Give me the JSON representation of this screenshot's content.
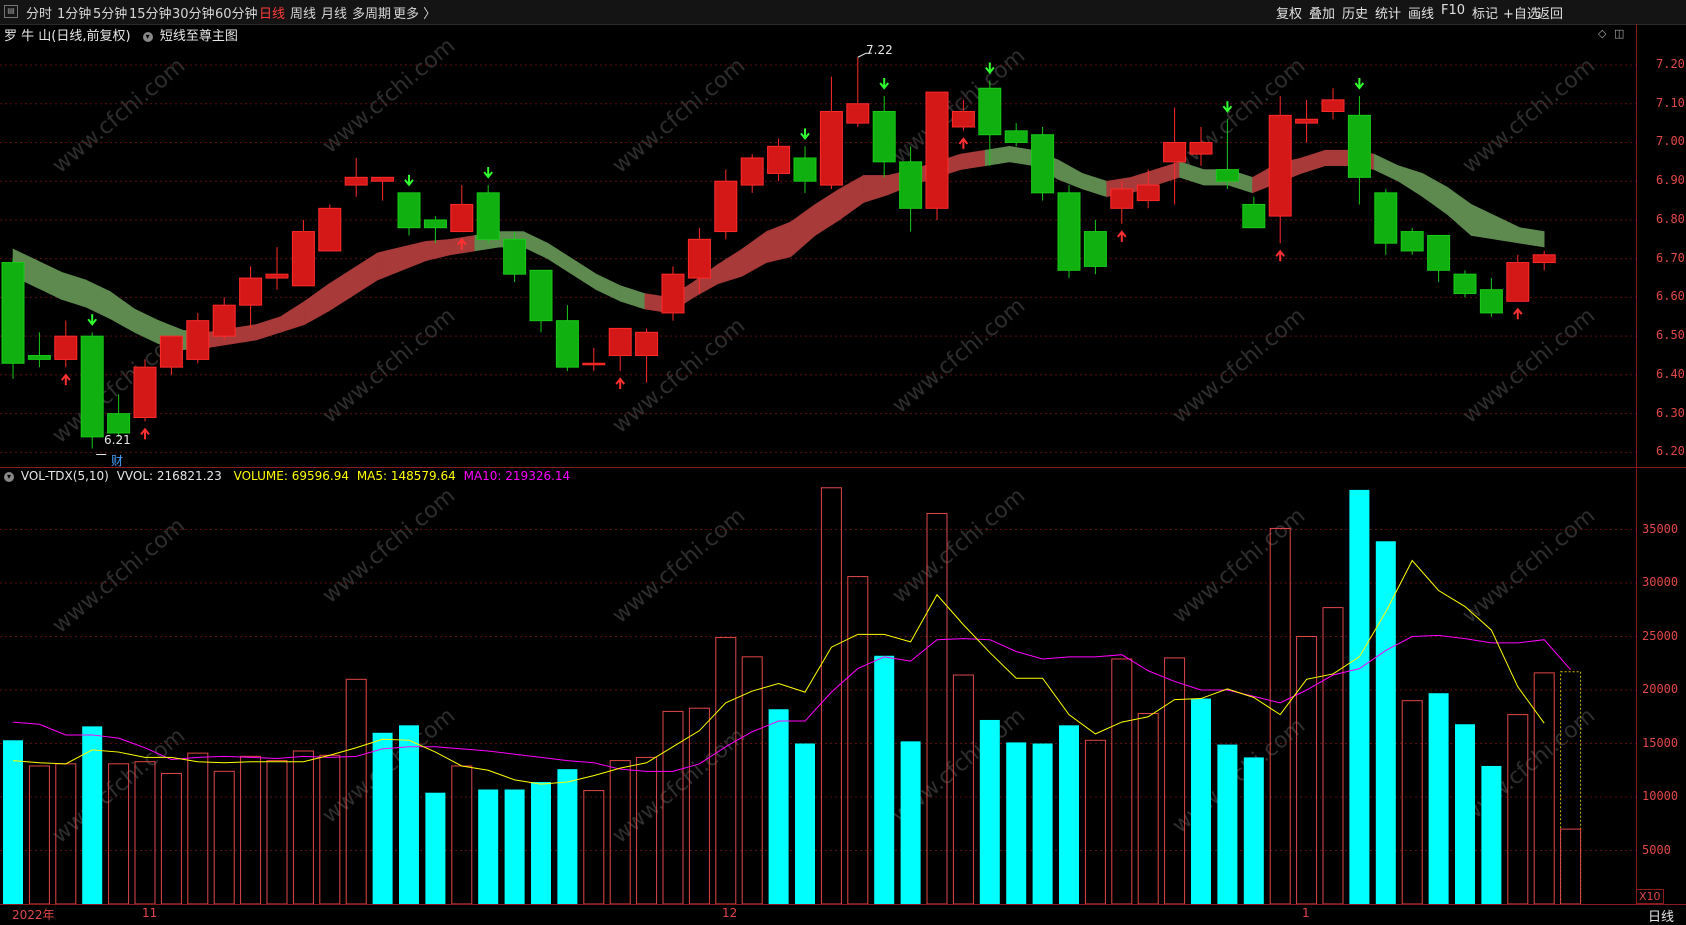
{
  "toolbar": {
    "periods": [
      "分时",
      "1分钟",
      "5分钟",
      "15分钟",
      "30分钟",
      "60分钟",
      "日线",
      "周线",
      "月线",
      "多周期",
      "更多 〉"
    ],
    "active_period": "日线",
    "right_buttons": [
      "复权",
      "叠加",
      "历史",
      "统计",
      "画线",
      "F10",
      "标记",
      "+自选",
      "返回"
    ]
  },
  "main_header": {
    "stock_title": "罗 牛 山(日线,前复权)",
    "indicator_name": "短线至尊主图"
  },
  "annotations": {
    "high_label": "7.22",
    "low_label": "6.21",
    "finance_marker": "财"
  },
  "vol_header": {
    "name": "VOL-TDX(5,10)",
    "vvol": "VVOL: 216821.23",
    "volume": "VOLUME: 69596.94",
    "ma5": "MA5: 148579.64",
    "ma10": "MA10: 219326.14"
  },
  "price_axis": [
    "7.20",
    "7.10",
    "7.00",
    "6.90",
    "6.80",
    "6.70",
    "6.60",
    "6.50",
    "6.40",
    "6.30",
    "6.20"
  ],
  "vol_axis": [
    "35000",
    "30000",
    "25000",
    "20000",
    "15000",
    "10000",
    "5000"
  ],
  "date_labels": [
    "2022年",
    "11",
    "12",
    "1"
  ],
  "corner": {
    "x10": "X10",
    "day": "日线"
  },
  "watermark": "www.cfchi.com",
  "colors": {
    "up": "#ff2a2a",
    "down": "#18c818",
    "vol_down": "#00ffff",
    "ma5": "#ffff00",
    "ma10": "#ff00ff",
    "axis": "#e04848"
  },
  "chart_data": [
    {
      "type": "candlestick",
      "title": "罗 牛 山(日线,前复权)",
      "ylim": [
        6.17,
        7.28
      ],
      "candles": [
        {
          "o": 6.69,
          "h": 6.7,
          "l": 6.39,
          "c": 6.43
        },
        {
          "o": 6.45,
          "h": 6.51,
          "l": 6.42,
          "c": 6.44
        },
        {
          "o": 6.44,
          "h": 6.54,
          "l": 6.42,
          "c": 6.5
        },
        {
          "o": 6.5,
          "h": 6.51,
          "l": 6.21,
          "c": 6.24
        },
        {
          "o": 6.3,
          "h": 6.35,
          "l": 6.24,
          "c": 6.25
        },
        {
          "o": 6.29,
          "h": 6.44,
          "l": 6.28,
          "c": 6.42
        },
        {
          "o": 6.42,
          "h": 6.5,
          "l": 6.4,
          "c": 6.5
        },
        {
          "o": 6.44,
          "h": 6.56,
          "l": 6.43,
          "c": 6.54
        },
        {
          "o": 6.5,
          "h": 6.6,
          "l": 6.49,
          "c": 6.58
        },
        {
          "o": 6.58,
          "h": 6.68,
          "l": 6.52,
          "c": 6.65
        },
        {
          "o": 6.65,
          "h": 6.73,
          "l": 6.62,
          "c": 6.66
        },
        {
          "o": 6.63,
          "h": 6.8,
          "l": 6.63,
          "c": 6.77
        },
        {
          "o": 6.72,
          "h": 6.84,
          "l": 6.72,
          "c": 6.83
        },
        {
          "o": 6.89,
          "h": 6.96,
          "l": 6.86,
          "c": 6.91
        },
        {
          "o": 6.9,
          "h": 6.91,
          "l": 6.85,
          "c": 6.91
        },
        {
          "o": 6.87,
          "h": 6.87,
          "l": 6.76,
          "c": 6.78
        },
        {
          "o": 6.8,
          "h": 6.81,
          "l": 6.74,
          "c": 6.78
        },
        {
          "o": 6.77,
          "h": 6.89,
          "l": 6.77,
          "c": 6.84
        },
        {
          "o": 6.87,
          "h": 6.89,
          "l": 6.74,
          "c": 6.75
        },
        {
          "o": 6.75,
          "h": 6.77,
          "l": 6.64,
          "c": 6.66
        },
        {
          "o": 6.67,
          "h": 6.67,
          "l": 6.51,
          "c": 6.54
        },
        {
          "o": 6.54,
          "h": 6.58,
          "l": 6.41,
          "c": 6.42
        },
        {
          "o": 6.43,
          "h": 6.47,
          "l": 6.41,
          "c": 6.43
        },
        {
          "o": 6.45,
          "h": 6.52,
          "l": 6.41,
          "c": 6.52
        },
        {
          "o": 6.45,
          "h": 6.52,
          "l": 6.38,
          "c": 6.51
        },
        {
          "o": 6.56,
          "h": 6.68,
          "l": 6.54,
          "c": 6.66
        },
        {
          "o": 6.65,
          "h": 6.78,
          "l": 6.61,
          "c": 6.75
        },
        {
          "o": 6.77,
          "h": 6.93,
          "l": 6.75,
          "c": 6.9
        },
        {
          "o": 6.89,
          "h": 6.97,
          "l": 6.87,
          "c": 6.96
        },
        {
          "o": 6.92,
          "h": 7.01,
          "l": 6.9,
          "c": 6.99
        },
        {
          "o": 6.96,
          "h": 6.99,
          "l": 6.87,
          "c": 6.9
        },
        {
          "o": 6.89,
          "h": 7.17,
          "l": 6.88,
          "c": 7.08
        },
        {
          "o": 7.05,
          "h": 7.22,
          "l": 7.04,
          "c": 7.1
        },
        {
          "o": 7.08,
          "h": 7.12,
          "l": 6.91,
          "c": 6.95
        },
        {
          "o": 6.95,
          "h": 6.99,
          "l": 6.77,
          "c": 6.83
        },
        {
          "o": 6.83,
          "h": 7.13,
          "l": 6.8,
          "c": 7.13
        },
        {
          "o": 7.04,
          "h": 7.11,
          "l": 7.03,
          "c": 7.08
        },
        {
          "o": 7.14,
          "h": 7.16,
          "l": 6.94,
          "c": 7.02
        },
        {
          "o": 7.03,
          "h": 7.05,
          "l": 6.99,
          "c": 7.0
        },
        {
          "o": 7.02,
          "h": 7.04,
          "l": 6.85,
          "c": 6.87
        },
        {
          "o": 6.87,
          "h": 6.89,
          "l": 6.65,
          "c": 6.67
        },
        {
          "o": 6.77,
          "h": 6.8,
          "l": 6.66,
          "c": 6.68
        },
        {
          "o": 6.83,
          "h": 6.9,
          "l": 6.79,
          "c": 6.88
        },
        {
          "o": 6.85,
          "h": 6.93,
          "l": 6.83,
          "c": 6.89
        },
        {
          "o": 6.95,
          "h": 7.09,
          "l": 6.84,
          "c": 7.0
        },
        {
          "o": 6.97,
          "h": 7.04,
          "l": 6.94,
          "c": 7.0
        },
        {
          "o": 6.93,
          "h": 7.06,
          "l": 6.88,
          "c": 6.9
        },
        {
          "o": 6.84,
          "h": 6.86,
          "l": 6.78,
          "c": 6.78
        },
        {
          "o": 6.81,
          "h": 7.12,
          "l": 6.74,
          "c": 7.07
        },
        {
          "o": 7.05,
          "h": 7.11,
          "l": 7.0,
          "c": 7.06
        },
        {
          "o": 7.08,
          "h": 7.14,
          "l": 7.06,
          "c": 7.11
        },
        {
          "o": 7.07,
          "h": 7.12,
          "l": 6.84,
          "c": 6.91
        },
        {
          "o": 6.87,
          "h": 6.88,
          "l": 6.71,
          "c": 6.74
        },
        {
          "o": 6.77,
          "h": 6.78,
          "l": 6.71,
          "c": 6.72
        },
        {
          "o": 6.76,
          "h": 6.76,
          "l": 6.64,
          "c": 6.67
        },
        {
          "o": 6.66,
          "h": 6.67,
          "l": 6.6,
          "c": 6.61
        },
        {
          "o": 6.62,
          "h": 6.65,
          "l": 6.55,
          "c": 6.56
        },
        {
          "o": 6.59,
          "h": 6.71,
          "l": 6.59,
          "c": 6.69
        },
        {
          "o": 6.69,
          "h": 6.72,
          "l": 6.67,
          "c": 6.71
        }
      ],
      "band_mid": [
        6.69,
        6.66,
        6.63,
        6.61,
        6.58,
        6.54,
        6.51,
        6.49,
        6.49,
        6.5,
        6.51,
        6.53,
        6.56,
        6.6,
        6.64,
        6.68,
        6.7,
        6.72,
        6.73,
        6.74,
        6.75,
        6.75,
        6.72,
        6.68,
        6.64,
        6.61,
        6.59,
        6.58,
        6.62,
        6.66,
        6.69,
        6.73,
        6.75,
        6.8,
        6.84,
        6.88,
        6.89,
        6.91,
        6.93,
        6.95,
        6.96,
        6.97,
        6.96,
        6.93,
        6.9,
        6.88,
        6.89,
        6.91,
        6.93,
        6.91,
        6.91,
        6.89,
        6.92,
        6.94,
        6.96,
        6.96,
        6.95,
        6.92,
        6.89,
        6.85,
        6.8,
        6.78,
        6.76,
        6.75
      ],
      "band_width": [
        0.035,
        0.035,
        0.035,
        0.035,
        0.035,
        0.03,
        0.03,
        0.025,
        0.02,
        0.02,
        0.02,
        0.02,
        0.03,
        0.035,
        0.035,
        0.035,
        0.03,
        0.025,
        0.02,
        0.02,
        0.02,
        0.02,
        0.02,
        0.02,
        0.02,
        0.02,
        0.02,
        0.02,
        0.02,
        0.025,
        0.035,
        0.04,
        0.045,
        0.04,
        0.04,
        0.035,
        0.025,
        0.02,
        0.02,
        0.02,
        0.02,
        0.02,
        0.02,
        0.025,
        0.02,
        0.02,
        0.02,
        0.02,
        0.02,
        0.02,
        0.02,
        0.02,
        0.025,
        0.02,
        0.02,
        0.02,
        0.02,
        0.02,
        0.03,
        0.035,
        0.04,
        0.03,
        0.02,
        0.02
      ],
      "band_up": [
        false,
        false,
        false,
        false,
        false,
        false,
        false,
        false,
        true,
        true,
        true,
        true,
        true,
        true,
        true,
        true,
        true,
        true,
        true,
        false,
        false,
        false,
        false,
        false,
        false,
        false,
        true,
        true,
        true,
        true,
        true,
        true,
        true,
        true,
        true,
        true,
        true,
        true,
        true,
        true,
        false,
        false,
        false,
        false,
        false,
        true,
        true,
        true,
        false,
        false,
        false,
        true,
        true,
        true,
        true,
        true,
        false,
        false,
        false,
        false,
        false,
        false,
        false,
        false
      ],
      "up_arrows": [
        2,
        5,
        17,
        23,
        36,
        42,
        48,
        57
      ],
      "down_arrows": [
        3,
        15,
        18,
        30,
        33,
        37,
        46,
        51
      ]
    },
    {
      "type": "bar",
      "title": "VOL-TDX(5,10)",
      "ylim": [
        0,
        40000
      ],
      "volumes": [
        15300,
        12900,
        13100,
        16600,
        13100,
        13300,
        12200,
        14100,
        12400,
        13800,
        13400,
        14300,
        13900,
        21000,
        16000,
        16700,
        10400,
        12900,
        10700,
        10700,
        11400,
        12600,
        10600,
        13400,
        13700,
        18000,
        18300,
        24900,
        23100,
        18200,
        15000,
        38900,
        30600,
        23200,
        15200,
        36500,
        21400,
        17200,
        15100,
        15000,
        16700,
        15300,
        22900,
        17800,
        23000,
        19200,
        14900,
        13700,
        35100,
        25000,
        27700,
        38700,
        33900,
        19000,
        19700,
        16800,
        12900,
        17700,
        21600
      ],
      "vol_up": [
        false,
        true,
        true,
        false,
        true,
        true,
        true,
        true,
        true,
        true,
        true,
        true,
        true,
        true,
        false,
        false,
        false,
        true,
        false,
        false,
        false,
        false,
        true,
        true,
        true,
        true,
        true,
        true,
        true,
        false,
        false,
        true,
        true,
        false,
        false,
        true,
        true,
        false,
        false,
        false,
        false,
        true,
        true,
        true,
        true,
        false,
        false,
        false,
        true,
        true,
        true,
        false,
        false,
        true,
        false,
        false,
        false,
        true,
        true
      ],
      "ma5": [
        13400,
        13200,
        13100,
        14400,
        14200,
        13700,
        13700,
        13300,
        13200,
        13300,
        13300,
        13300,
        13900,
        14600,
        15400,
        15300,
        14200,
        12900,
        12500,
        11600,
        11200,
        11400,
        12000,
        12700,
        13200,
        14700,
        16200,
        18800,
        19900,
        20600,
        19800,
        24000,
        25200,
        25200,
        24500,
        28900,
        26100,
        23500,
        21100,
        21100,
        17700,
        15900,
        17000,
        17500,
        19100,
        19200,
        20100,
        19300,
        17700,
        21000,
        21500,
        23100,
        27300,
        32100,
        29300,
        27800,
        25600,
        20300,
        16900
      ],
      "ma10": [
        17000,
        16800,
        15800,
        15800,
        15500,
        14600,
        13500,
        13700,
        13800,
        13700,
        13600,
        13800,
        13700,
        13800,
        14500,
        14700,
        14700,
        14500,
        14300,
        14000,
        13700,
        13400,
        13200,
        12600,
        12400,
        12400,
        13100,
        14700,
        16100,
        17100,
        17100,
        19800,
        22000,
        23100,
        22700,
        24700,
        24800,
        24700,
        23600,
        22900,
        23100,
        23100,
        23300,
        21800,
        20800,
        20000,
        20000,
        19400,
        18800,
        20000,
        21400,
        22000,
        23700,
        25000,
        25100,
        24800,
        24400,
        24400,
        24700,
        21900
      ]
    }
  ]
}
